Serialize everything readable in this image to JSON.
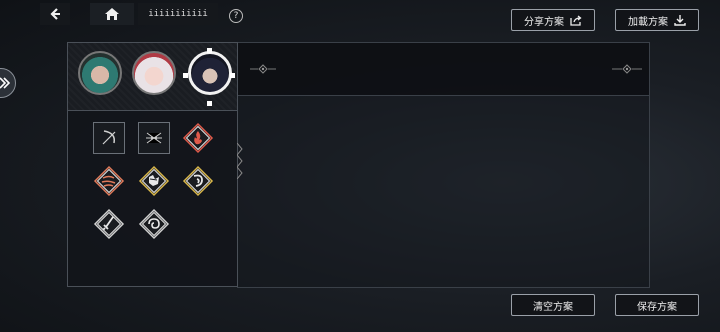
{
  "topbar": {
    "breadcrumb_label": "iiiiiiiiiii",
    "help_symbol": "?"
  },
  "buttons": {
    "share_label": "分享方案",
    "load_label": "加載方案",
    "clear_label": "清空方案",
    "save_label": "保存方案"
  },
  "characters": [
    {
      "name": "character-1",
      "selected": false
    },
    {
      "name": "character-2",
      "selected": false
    },
    {
      "name": "character-3",
      "selected": true
    }
  ],
  "skills": [
    {
      "icon": "bow-icon",
      "style": "square",
      "color": "#d0d0d0"
    },
    {
      "icon": "spider-icon",
      "style": "square",
      "color": "#d0d0d0"
    },
    {
      "icon": "flame-icon",
      "style": "diamond",
      "color": "#e05a4a"
    },
    {
      "icon": "wind-icon",
      "style": "diamond",
      "color": "#e07a5a"
    },
    {
      "icon": "fist-icon",
      "style": "diamond",
      "color": "#d8b64a"
    },
    {
      "icon": "dragon-icon",
      "style": "diamond",
      "color": "#d8b64a"
    },
    {
      "icon": "sword-icon",
      "style": "diamond",
      "color": "#d0d0d0"
    },
    {
      "icon": "swirl-icon",
      "style": "diamond",
      "color": "#d0d0d0"
    }
  ],
  "colors": {
    "accent_red": "#e05a4a",
    "accent_gold": "#d8b64a",
    "border": "#9aa0a8"
  }
}
